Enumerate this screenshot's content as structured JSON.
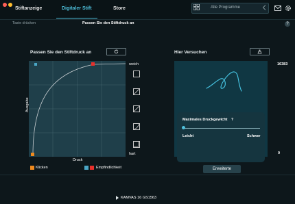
{
  "colors": {
    "accent": "#4fc0dc",
    "click_marker": "#f08a1e",
    "sensitivity_marker": "#e8302b",
    "close": "#ff5f56",
    "minimize": "#ffbd2e",
    "curve_bg": "#1f3f4a"
  },
  "tabs": [
    {
      "label": "Stiftanzeige",
      "active": false
    },
    {
      "label": "Digitaler Stift",
      "active": true
    },
    {
      "label": "Store",
      "active": false
    }
  ],
  "search": {
    "placeholder": "Alle Programme"
  },
  "icons": {
    "apps": "grid-icon",
    "back": "chevron-left-icon",
    "mail": "mail-icon",
    "settings": "gear-icon",
    "help": "question-icon",
    "reset": "reset-icon",
    "clear": "brush-icon",
    "device_arrow": "triangle-right-icon"
  },
  "toolbar": {
    "key_label": "Taste drücken",
    "adjust_label": "Passen Sie den Stiftdruck an",
    "help_label": "?"
  },
  "pressure_panel": {
    "title": "Passen Sie den Stiftdruck an",
    "weich": "weich",
    "hart": "hart",
    "x_axis": "Druck",
    "y_axis": "Ausgabe",
    "legend": [
      {
        "label": "Klicken",
        "color": "#f08a1e"
      },
      {
        "label": "Empfindlichkeit",
        "color": "#e8302b"
      }
    ]
  },
  "try_panel": {
    "title": "Hier Versuchen",
    "max_value": "16383",
    "min_value": "0"
  },
  "popup": {
    "title": "Maximales Druckgewicht",
    "help": "?",
    "left": "Leicht",
    "right": "Schwer",
    "slider_value": 0
  },
  "advanced_button": "Erweiterte",
  "device": "KAMVAS 16 GS1563"
}
